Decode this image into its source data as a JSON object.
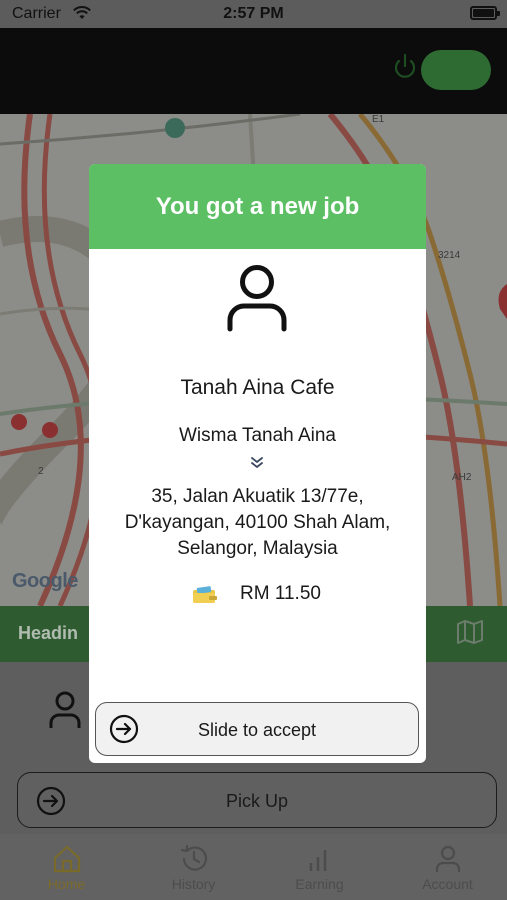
{
  "status_bar": {
    "carrier": "Carrier",
    "time": "2:57 PM"
  },
  "map": {
    "attribution": "Google",
    "road_labels": [
      "E1",
      "3214",
      "AH2",
      "2"
    ]
  },
  "heading_row": {
    "label": "Headin"
  },
  "pickup_button": {
    "label": "Pick Up"
  },
  "tabs": [
    {
      "label": "Home",
      "icon": "home-icon",
      "active": true
    },
    {
      "label": "History",
      "icon": "history-icon",
      "active": false
    },
    {
      "label": "Earning",
      "icon": "earning-icon",
      "active": false
    },
    {
      "label": "Account",
      "icon": "account-icon",
      "active": false
    }
  ],
  "modal": {
    "title": "You got a new job",
    "shop_name": "Tanah Aina Cafe",
    "building": "Wisma Tanah Aina",
    "address": "35, Jalan Akuatik 13/77e, D'kayangan, 40100 Shah Alam, Selangor, Malaysia",
    "fare": "RM 11.50",
    "slide_label": "Slide to accept"
  },
  "colors": {
    "modal_header": "#5cbf64",
    "overlay_dim": "#000000",
    "brand_green": "#5cbf64"
  }
}
